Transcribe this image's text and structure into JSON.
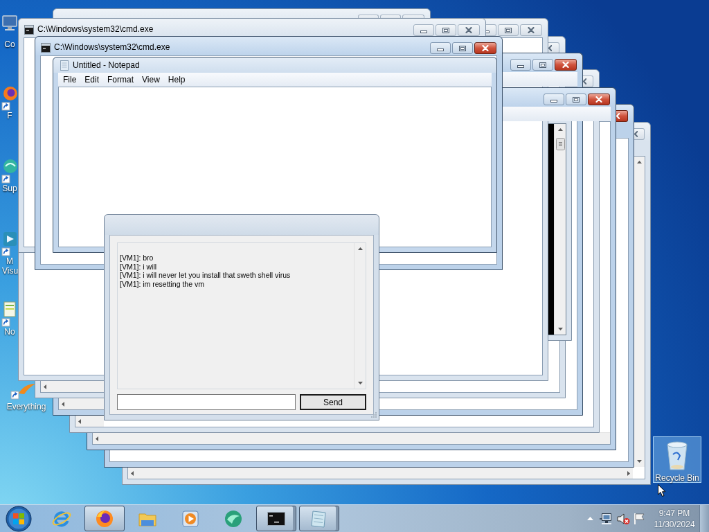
{
  "desktop_icons": [
    {
      "label": "Co",
      "kind": "computer",
      "selected": false
    },
    {
      "label": "F",
      "kind": "firefox",
      "selected": false
    },
    {
      "label": "Sup",
      "kind": "orb",
      "selected": false
    },
    {
      "label": "M Visu",
      "kind": "studio",
      "selected": false
    },
    {
      "label": "No",
      "kind": "editor",
      "selected": false
    },
    {
      "label": "Everything",
      "kind": "search",
      "selected": false
    },
    {
      "label": "Recycle Bin",
      "kind": "recycle",
      "selected": true
    }
  ],
  "windows": [
    {
      "kind": "doc",
      "active": false
    },
    {
      "kind": "doc",
      "active": true
    },
    {
      "kind": "doc",
      "active": true
    },
    {
      "kind": "doc",
      "active": false
    },
    {
      "kind": "doc",
      "active": true
    },
    {
      "kind": "blank",
      "active": false
    },
    {
      "kind": "console"
    },
    {
      "kind": "blank",
      "active": false
    },
    {
      "kind": "blank",
      "active": false
    },
    {
      "kind": "cmd",
      "title": "C:\\Windows\\system32\\cmd.exe",
      "active": false
    },
    {
      "kind": "cmd",
      "title": "C:\\Windows\\system32\\cmd.exe",
      "active": true
    },
    {
      "kind": "notepad",
      "title": "Untitled - Notepad",
      "menus": [
        "File",
        "Edit",
        "Format",
        "View",
        "Help"
      ]
    }
  ],
  "chat_window": {
    "messages": [
      "[VM1]: bro",
      "[VM1]: i will",
      "[VM1]: i will never let you install that sweth shell virus",
      "[VM1]: im resetting the vm"
    ],
    "send_button": "Send"
  },
  "taskbar": {
    "items": [
      {
        "kind": "ie",
        "running": false,
        "stacked": false
      },
      {
        "kind": "firefox",
        "running": true,
        "stacked": false
      },
      {
        "kind": "explorer",
        "running": false,
        "stacked": false
      },
      {
        "kind": "media",
        "running": false,
        "stacked": false
      },
      {
        "kind": "orb",
        "running": false,
        "stacked": false
      },
      {
        "kind": "console",
        "running": true,
        "stacked": true
      },
      {
        "kind": "notepad",
        "running": true,
        "stacked": true
      }
    ]
  },
  "tray": {
    "muted": true,
    "time": "9:47 PM",
    "date": "11/30/2024"
  }
}
